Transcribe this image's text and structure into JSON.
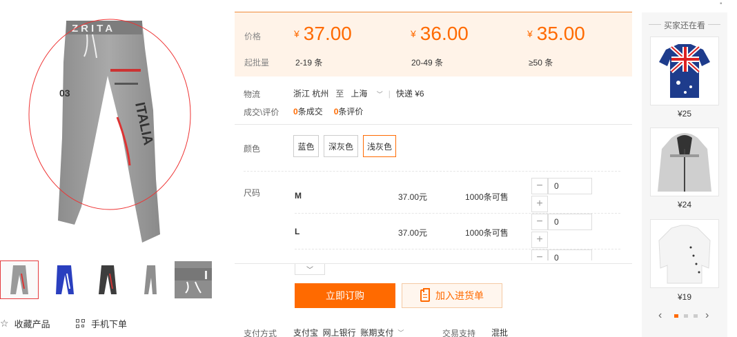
{
  "gallery": {
    "main_print_text": "ZRITA",
    "main_print_side": "ITALIA"
  },
  "left_actions": {
    "favorite_label": "收藏产品",
    "mobile_order_label": "手机下单"
  },
  "price_box": {
    "price_label": "价格",
    "moq_label": "起批量",
    "currency": "¥",
    "tiers": [
      {
        "price": "37.00",
        "qty": "2-19 条"
      },
      {
        "price": "36.00",
        "qty": "20-49 条"
      },
      {
        "price": "35.00",
        "qty": "≥50 条"
      }
    ]
  },
  "logistics": {
    "label": "物流",
    "from": "浙江 杭州",
    "to_word": "至",
    "to": "上海",
    "express": "快递 ¥6"
  },
  "deals": {
    "label": "成交\\评价",
    "deal_count": "0",
    "deal_text": "条成交",
    "review_count": "0",
    "review_text": "条评价"
  },
  "color": {
    "label": "颜色",
    "options": [
      "蓝色",
      "深灰色",
      "浅灰色"
    ],
    "selected": "浅灰色"
  },
  "size": {
    "label": "尺码",
    "rows": [
      {
        "name": "M",
        "price": "37.00元",
        "stock": "1000条可售",
        "qty": "0"
      },
      {
        "name": "L",
        "price": "37.00元",
        "stock": "1000条可售",
        "qty": "0"
      },
      {
        "qty": "0"
      }
    ]
  },
  "buttons": {
    "buy": "立即订购",
    "cart": "加入进货单"
  },
  "payment": {
    "label": "支付方式",
    "methods": "支付宝  网上银行  账期支付",
    "trade_label": "交易支持",
    "trade_value": "混批"
  },
  "recommend": {
    "title": "买家还在看",
    "items": [
      {
        "price": "¥25",
        "icon": "tshirt-flag-image"
      },
      {
        "price": "¥24",
        "icon": "hoodie-image"
      },
      {
        "price": "¥19",
        "icon": "white-shirt-image"
      }
    ],
    "prev": "‹",
    "next": "›"
  },
  "colors": {
    "accent": "#ff6a00",
    "price_bg": "#fff3e8"
  }
}
